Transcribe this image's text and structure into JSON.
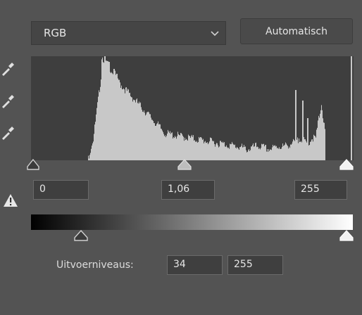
{
  "channel": {
    "value": "RGB",
    "chevron_icon": "chevron-down-icon"
  },
  "auto_button": {
    "label": "Automatisch"
  },
  "eyedroppers": [
    "eyedropper-black-point-icon",
    "eyedropper-gray-point-icon",
    "eyedropper-white-point-icon"
  ],
  "warning_icon": "warning-icon",
  "input_levels": {
    "shadows": "0",
    "midtones": "1,06",
    "highlights": "255"
  },
  "output_levels": {
    "label": "Uitvoerniveaus:",
    "shadows": "34",
    "highlights": "255"
  },
  "colors": {
    "panel": "#535353",
    "histogram_bg": "#3e3e3e",
    "histogram_bars": "#c8c8c8",
    "field_bg": "#3f3f3f",
    "slider_handle": "#cfcfcf"
  }
}
